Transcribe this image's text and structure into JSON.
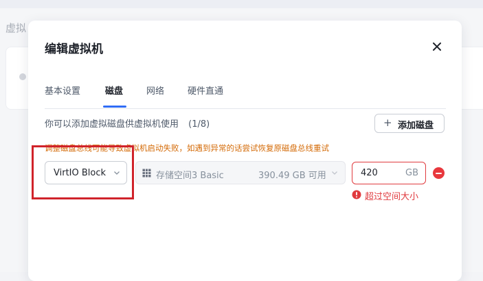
{
  "background": {
    "page_title": "虚拟"
  },
  "dialog": {
    "title": "编辑虚拟机",
    "tabs": [
      {
        "label": "基本设置",
        "active": false
      },
      {
        "label": "磁盘",
        "active": true
      },
      {
        "label": "网络",
        "active": false
      },
      {
        "label": "硬件直通",
        "active": false
      }
    ],
    "info_text": "你可以添加虚拟磁盘供虚拟机使用",
    "disk_count": "(1/8)",
    "add_disk": {
      "icon": "plus-icon",
      "label": "添加磁盘"
    },
    "warning_text": "调整磁盘总线可能导致虚拟机启动失败，如遇到异常的话尝试恢复原磁盘总线重试",
    "disk": {
      "bus": "VirtIO Block",
      "storage_name": "存储空间3 Basic",
      "storage_available": "390.49 GB 可用",
      "size_value": "420",
      "size_unit": "GB",
      "error_text": "超过空间大小"
    }
  },
  "colors": {
    "accent": "#2f6cf6",
    "error": "#e03a3e",
    "warning": "#d46b08",
    "highlight": "#d0232a"
  }
}
